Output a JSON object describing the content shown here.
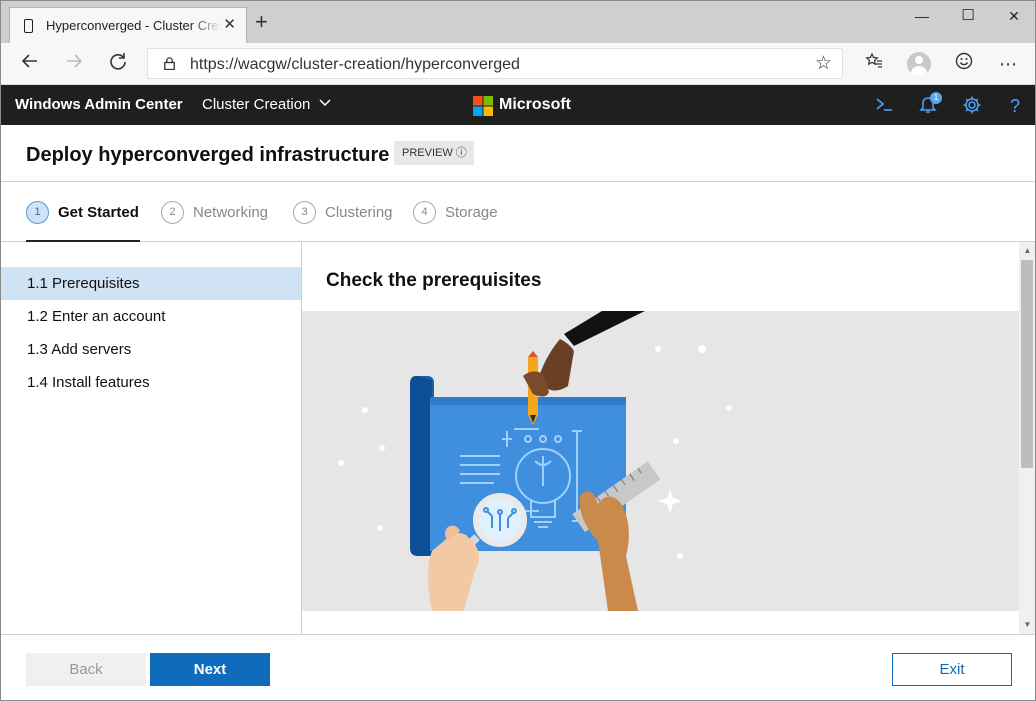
{
  "browser": {
    "tab_title": "Hyperconverged - Cluster Creation",
    "tab_close": "✕",
    "new_tab": "+",
    "window_controls": {
      "minimize": "—",
      "maximize": "☐",
      "close": "✕"
    },
    "url": "https://wacgw/cluster-creation/hyperconverged",
    "nav_icons": [
      "back-icon",
      "forward-icon",
      "refresh-icon",
      "lock-icon",
      "favorite-star-icon",
      "favorites-icon",
      "profile-icon",
      "feedback-icon",
      "more-icon"
    ]
  },
  "appbar": {
    "brand": "Windows Admin Center",
    "breadcrumb": "Cluster Creation",
    "company": "Microsoft",
    "notification_count": "1",
    "icons": [
      "powershell-icon",
      "notifications-icon",
      "settings-icon",
      "help-icon"
    ]
  },
  "page": {
    "title": "Deploy hyperconverged infrastructure",
    "badge": "PREVIEW ⓘ"
  },
  "stepper": {
    "steps": [
      {
        "num": "1",
        "label": "Get Started",
        "active": true
      },
      {
        "num": "2",
        "label": "Networking",
        "active": false
      },
      {
        "num": "3",
        "label": "Clustering",
        "active": false
      },
      {
        "num": "4",
        "label": "Storage",
        "active": false
      }
    ]
  },
  "leftnav": {
    "items": [
      {
        "label": "1.1  Prerequisites",
        "selected": true
      },
      {
        "label": "1.2  Enter an account",
        "selected": false
      },
      {
        "label": "1.3  Add servers",
        "selected": false
      },
      {
        "label": "1.4  Install features",
        "selected": false
      }
    ]
  },
  "content": {
    "heading": "Check the prerequisites",
    "illustration": "blueprint-lightbulb-illustration"
  },
  "footer": {
    "back": "Back",
    "next": "Next",
    "exit": "Exit"
  },
  "colors": {
    "appbar_bg": "#1f1f1f",
    "accent": "#0f6cbd",
    "selected_bg": "#cfe3f5",
    "blueprint": "#3f8fde"
  }
}
